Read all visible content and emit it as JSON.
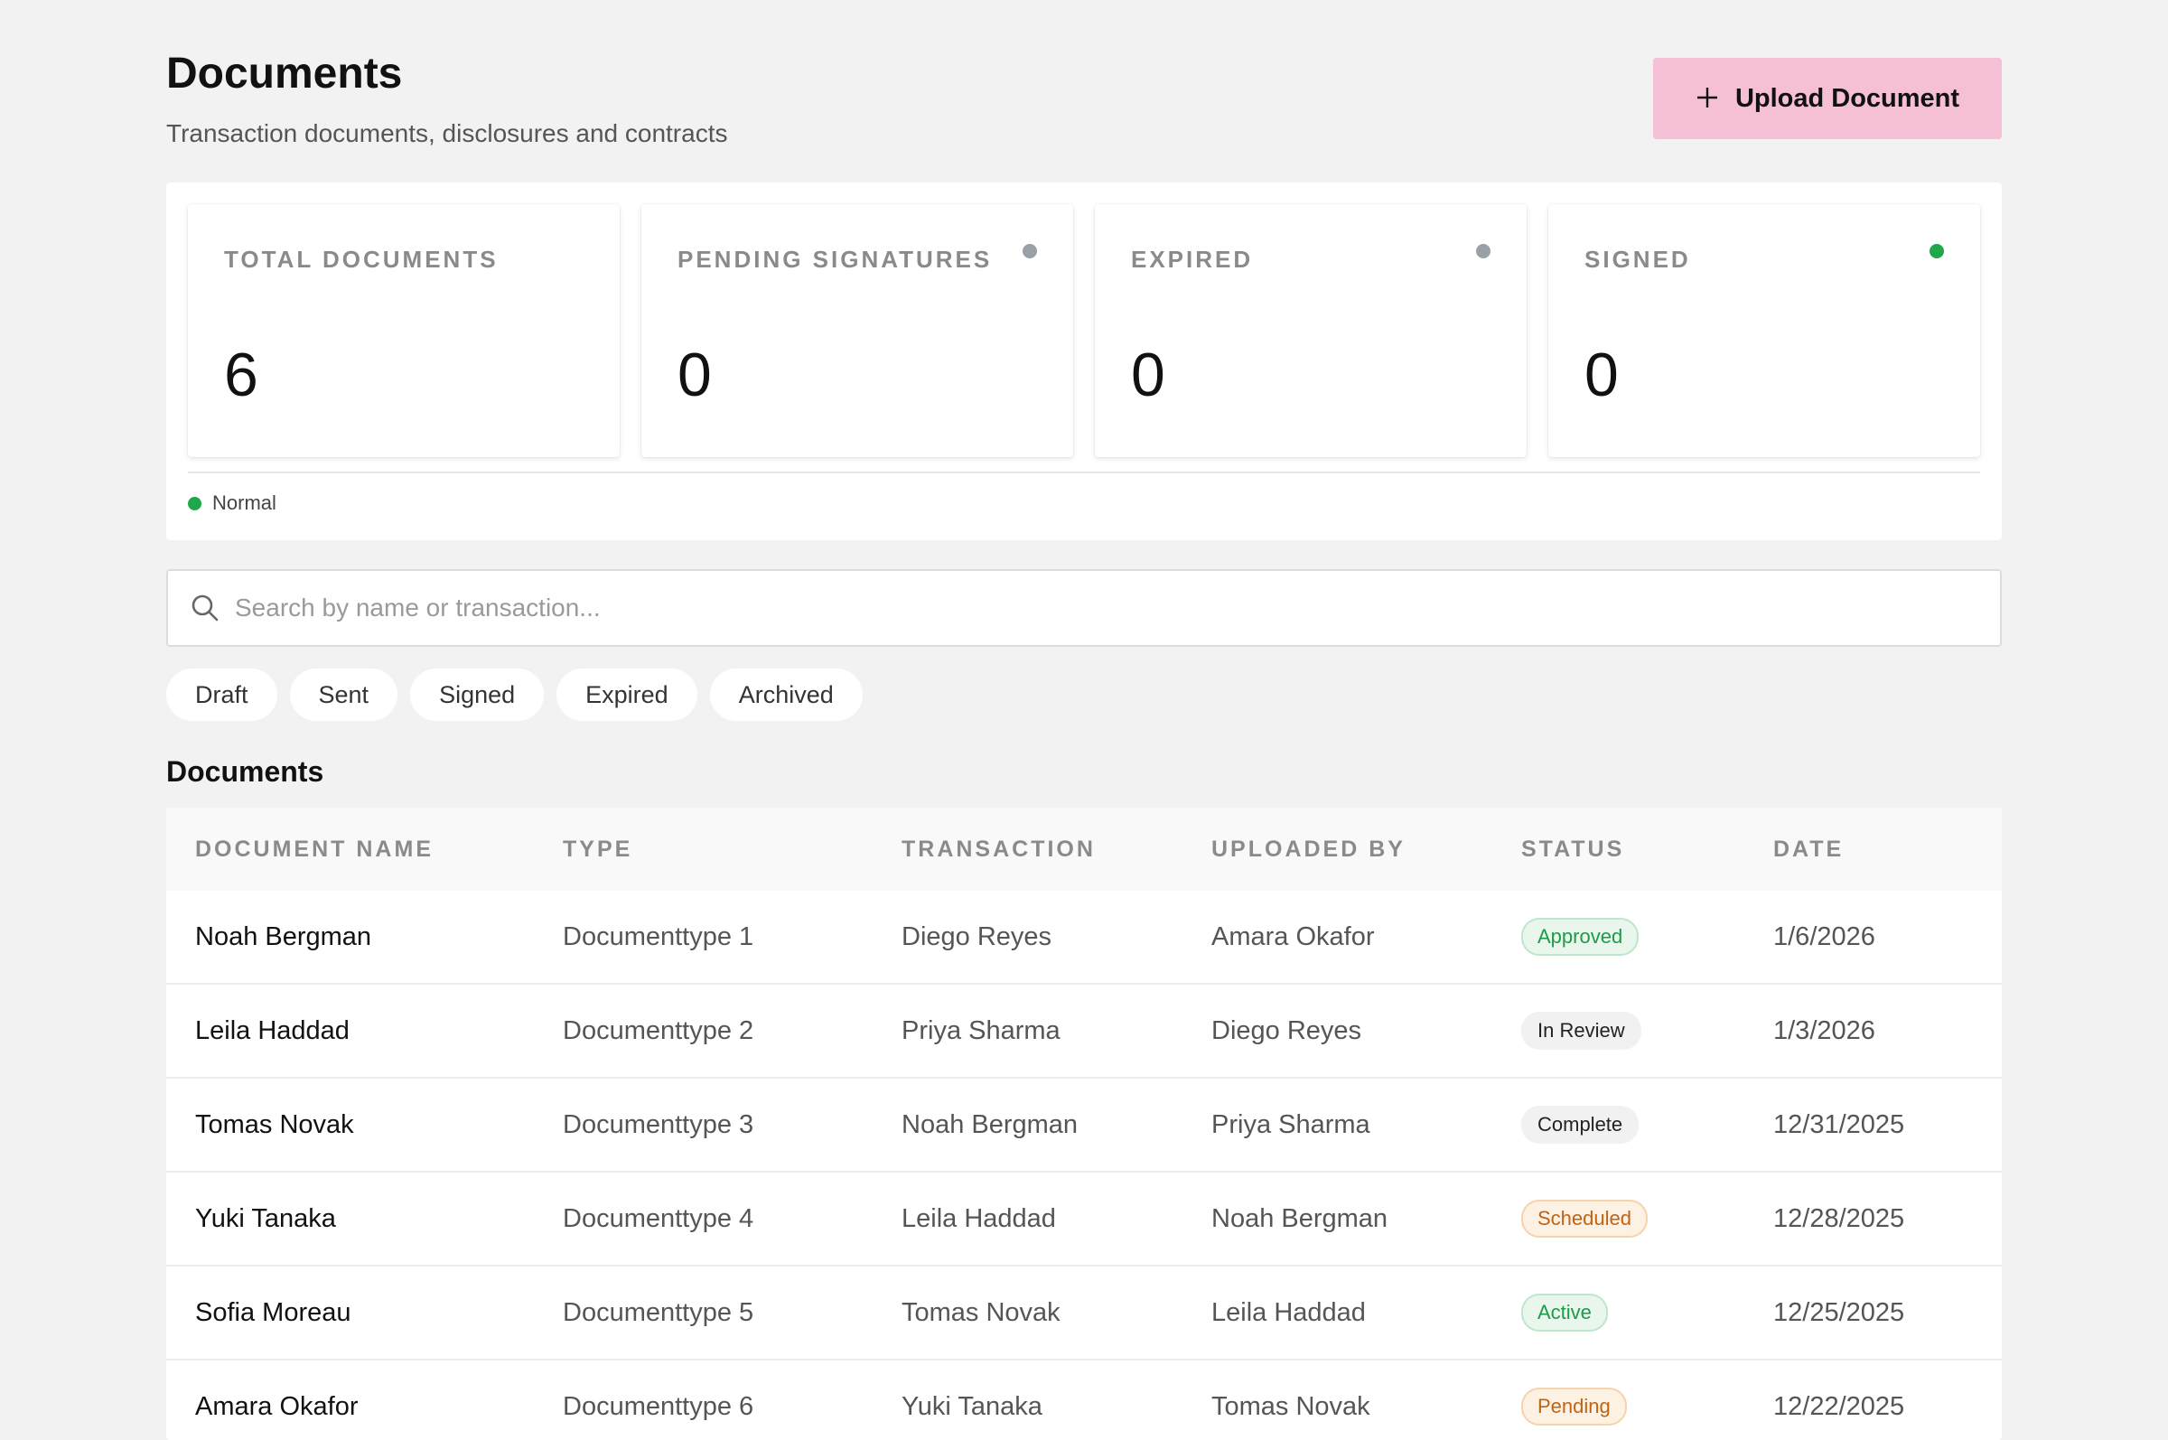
{
  "header": {
    "title": "Documents",
    "subtitle": "Transaction documents, disclosures and contracts",
    "upload_label": "Upload Document",
    "upload_icon": "plus-icon"
  },
  "stats": [
    {
      "label": "TOTAL DOCUMENTS",
      "value": "6",
      "dot": null
    },
    {
      "label": "PENDING SIGNATURES",
      "value": "0",
      "dot": "#9aa0a8"
    },
    {
      "label": "EXPIRED",
      "value": "0",
      "dot": "#9aa0a8"
    },
    {
      "label": "SIGNED",
      "value": "0",
      "dot": "#1fa84a"
    }
  ],
  "legend": {
    "label": "Normal",
    "color": "#1fa84a"
  },
  "search": {
    "placeholder": "Search by name or transaction...",
    "icon": "search-icon"
  },
  "filters": [
    "Draft",
    "Sent",
    "Signed",
    "Expired",
    "Archived"
  ],
  "table": {
    "title": "Documents",
    "columns": [
      "DOCUMENT NAME",
      "TYPE",
      "TRANSACTION",
      "UPLOADED BY",
      "STATUS",
      "DATE"
    ],
    "rows": [
      {
        "name": "Noah Bergman",
        "type": "Documenttype 1",
        "transaction": "Diego Reyes",
        "uploaded_by": "Amara Okafor",
        "status": "Approved",
        "status_tone": "green",
        "date": "1/6/2026"
      },
      {
        "name": "Leila Haddad",
        "type": "Documenttype 2",
        "transaction": "Priya Sharma",
        "uploaded_by": "Diego Reyes",
        "status": "In Review",
        "status_tone": "gray",
        "date": "1/3/2026"
      },
      {
        "name": "Tomas Novak",
        "type": "Documenttype 3",
        "transaction": "Noah Bergman",
        "uploaded_by": "Priya Sharma",
        "status": "Complete",
        "status_tone": "gray",
        "date": "12/31/2025"
      },
      {
        "name": "Yuki Tanaka",
        "type": "Documenttype 4",
        "transaction": "Leila Haddad",
        "uploaded_by": "Noah Bergman",
        "status": "Scheduled",
        "status_tone": "orange",
        "date": "12/28/2025"
      },
      {
        "name": "Sofia Moreau",
        "type": "Documenttype 5",
        "transaction": "Tomas Novak",
        "uploaded_by": "Leila Haddad",
        "status": "Active",
        "status_tone": "green",
        "date": "12/25/2025"
      },
      {
        "name": "Amara Okafor",
        "type": "Documenttype 6",
        "transaction": "Yuki Tanaka",
        "uploaded_by": "Tomas Novak",
        "status": "Pending",
        "status_tone": "orange",
        "date": "12/22/2025"
      }
    ]
  },
  "colors": {
    "accent": "#f5bfd6",
    "background": "#f2f2f2"
  }
}
